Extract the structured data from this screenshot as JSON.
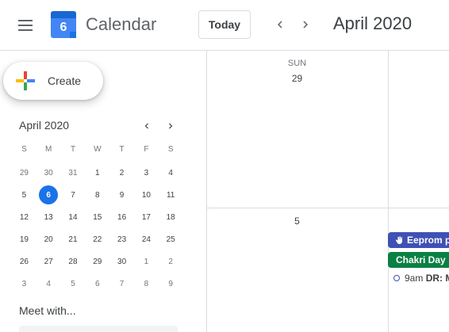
{
  "header": {
    "app_title": "Calendar",
    "logo_day": "6",
    "today_label": "Today",
    "current_period": "April 2020"
  },
  "sidebar": {
    "create_label": "Create",
    "mini_calendar": {
      "month_label": "April 2020",
      "weekday_headers": [
        "S",
        "M",
        "T",
        "W",
        "T",
        "F",
        "S"
      ],
      "weeks": [
        [
          "29",
          "30",
          "31",
          "1",
          "2",
          "3",
          "4"
        ],
        [
          "5",
          "6",
          "7",
          "8",
          "9",
          "10",
          "11"
        ],
        [
          "12",
          "13",
          "14",
          "15",
          "16",
          "17",
          "18"
        ],
        [
          "19",
          "20",
          "21",
          "22",
          "23",
          "24",
          "25"
        ],
        [
          "26",
          "27",
          "28",
          "29",
          "30",
          "1",
          "2"
        ],
        [
          "3",
          "4",
          "5",
          "6",
          "7",
          "8",
          "9"
        ]
      ],
      "today": "6"
    },
    "meet_with_label": "Meet with..."
  },
  "grid": {
    "first_column": {
      "day_name": "SUN",
      "week1_date": "29",
      "week2_date": "5"
    },
    "events": {
      "allday1": "Eeprom p",
      "allday2": "Chakri Day",
      "timed_time": "9am",
      "timed_title": "DR: M"
    }
  },
  "colors": {
    "accent": "#1a73e8",
    "event_blue": "#3f51b5",
    "event_green": "#0b8043"
  }
}
